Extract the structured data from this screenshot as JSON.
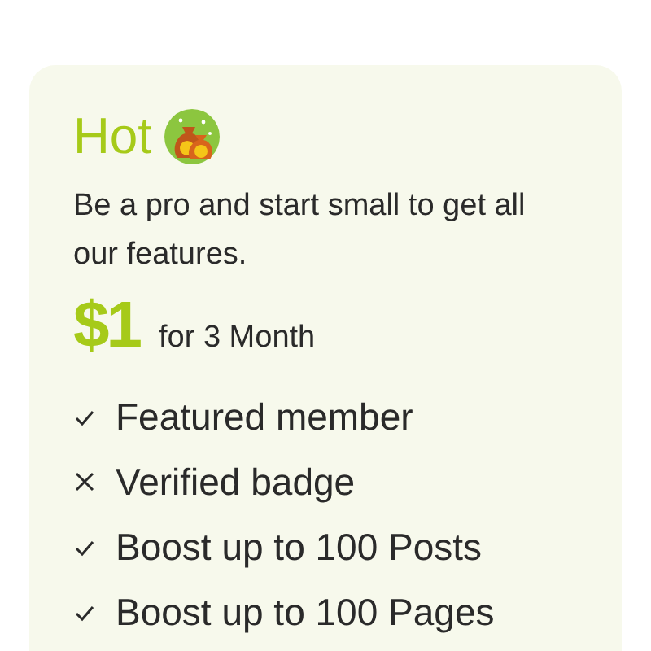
{
  "plan": {
    "title": "Hot",
    "description": "Be a pro and start small to get all our features.",
    "price": "$1",
    "period": "for 3 Month",
    "features": [
      {
        "label": "Featured member",
        "included": true
      },
      {
        "label": "Verified badge",
        "included": false
      },
      {
        "label": "Boost up to 100 Posts",
        "included": true
      },
      {
        "label": "Boost up to 100 Pages",
        "included": true
      }
    ]
  }
}
